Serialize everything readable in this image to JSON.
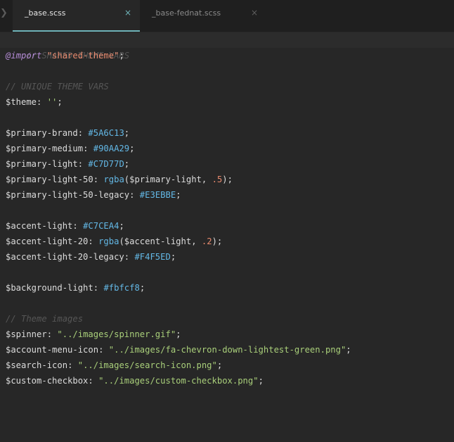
{
  "tabs": [
    {
      "label": "_base.scss",
      "active": true
    },
    {
      "label": "_base-fednat.scss",
      "active": false
    }
  ],
  "icons": {
    "close": "×",
    "sidebar": "❯"
  },
  "code": {
    "c1": "// SHARED THEME VARS",
    "import_kw": "@import",
    "import_str": "\"shared-theme\"",
    "c2": "// UNIQUE THEME VARS",
    "theme_var": "$theme",
    "theme_val": "''",
    "pb_var": "$primary-brand",
    "pb_val": "#5A6C13",
    "pm_var": "$primary-medium",
    "pm_val": "#90AA29",
    "pl_var": "$primary-light",
    "pl_val": "#C7D77D",
    "pl50_var": "$primary-light-50",
    "pl50_fn": "rgba",
    "pl50_arg": "$primary-light",
    "pl50_num": ".5",
    "pl50l_var": "$primary-light-50-legacy",
    "pl50l_val": "#E3EBBE",
    "al_var": "$accent-light",
    "al_val": "#C7CEA4",
    "al20_var": "$accent-light-20",
    "al20_fn": "rgba",
    "al20_arg": "$accent-light",
    "al20_num": ".2",
    "al20l_var": "$accent-light-20-legacy",
    "al20l_val": "#F4F5ED",
    "bg_var": "$background-light",
    "bg_val": "#fbfcf8",
    "c3": "// Theme images",
    "sp_var": "$spinner",
    "sp_val": "\"../images/spinner.gif\"",
    "am_var": "$account-menu-icon",
    "am_val": "\"../images/fa-chevron-down-lightest-green.png\"",
    "si_var": "$search-icon",
    "si_val": "\"../images/search-icon.png\"",
    "cc_var": "$custom-checkbox",
    "cc_val": "\"../images/custom-checkbox.png\""
  },
  "colors": {
    "background": "#272727",
    "tab_bar": "#1f1f1f",
    "accent": "#6fb3b8",
    "comment": "#565656",
    "string": "#a9cf7a",
    "hex": "#63b8e6",
    "number": "#e88a6e"
  }
}
